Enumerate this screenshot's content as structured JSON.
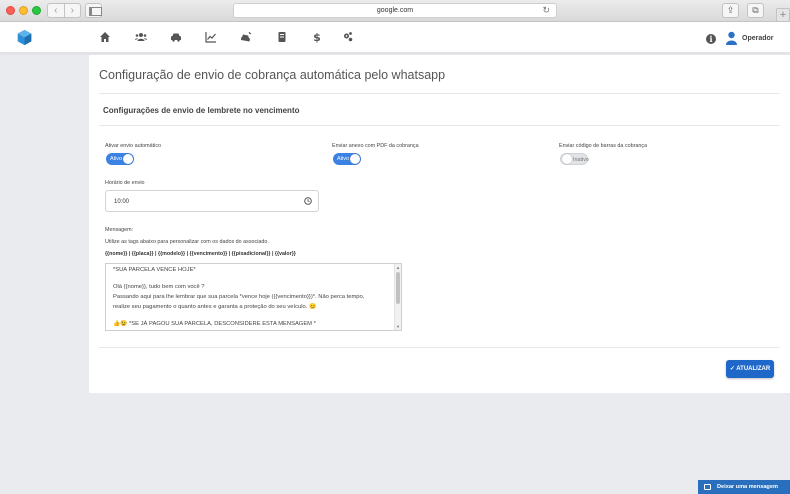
{
  "browser": {
    "url": "google.com"
  },
  "nav": {
    "icons": [
      "home-icon",
      "users-icon",
      "car-icon",
      "chart-icon",
      "car-crash-icon",
      "document-icon",
      "dollar-icon",
      "gear-icon"
    ],
    "user_label": "Operador"
  },
  "page": {
    "title": "Configuração de envio de cobrança automática pelo whatsapp",
    "section_title": "Configurações de envio de lembrete no vencimento"
  },
  "settings": {
    "auto_send": {
      "label": "Ativar envio automático",
      "state": "Ativo",
      "enabled": true
    },
    "pdf_attach": {
      "label": "Enviar anexo com PDF da cobrança",
      "state": "Ativo",
      "enabled": true
    },
    "barcode": {
      "label": "Enviar código de barras da cobrança",
      "state": "Inativo",
      "enabled": false
    },
    "send_time": {
      "label": "Horário de envio",
      "value": "10:00"
    }
  },
  "message": {
    "label": "Mensagem:",
    "help": "Utilize as tags abaixo para personalizar com os dados do associado.",
    "tags": "{{nome}} | {{placa}} | {{modelo}} | {{vencimento}} | {{pixadicional}} | {{valor}}",
    "lines": [
      "*SUA PARCELA VENCE HOJE*",
      "Olá {{nome}}, tudo bem com você ?",
      "Passando aqui para lhe lembrar que sua parcela *vence hoje ({{vencimento}})*. Não perca tempo,",
      "realize seu pagamento o quanto antes e garanta a proteção do seu veículo. 😊",
      "👍😉 *SE JÁ PAGOU SUA PARCELA, DESCONSIDERE ESTA MENSAGEM *"
    ]
  },
  "actions": {
    "update": "✓ ATUALIZAR"
  },
  "chat": {
    "label": "Deixar uma mensagem"
  },
  "colors": {
    "accent": "#3b82e2",
    "button": "#1f67c9",
    "chat": "#2a6fbd"
  }
}
